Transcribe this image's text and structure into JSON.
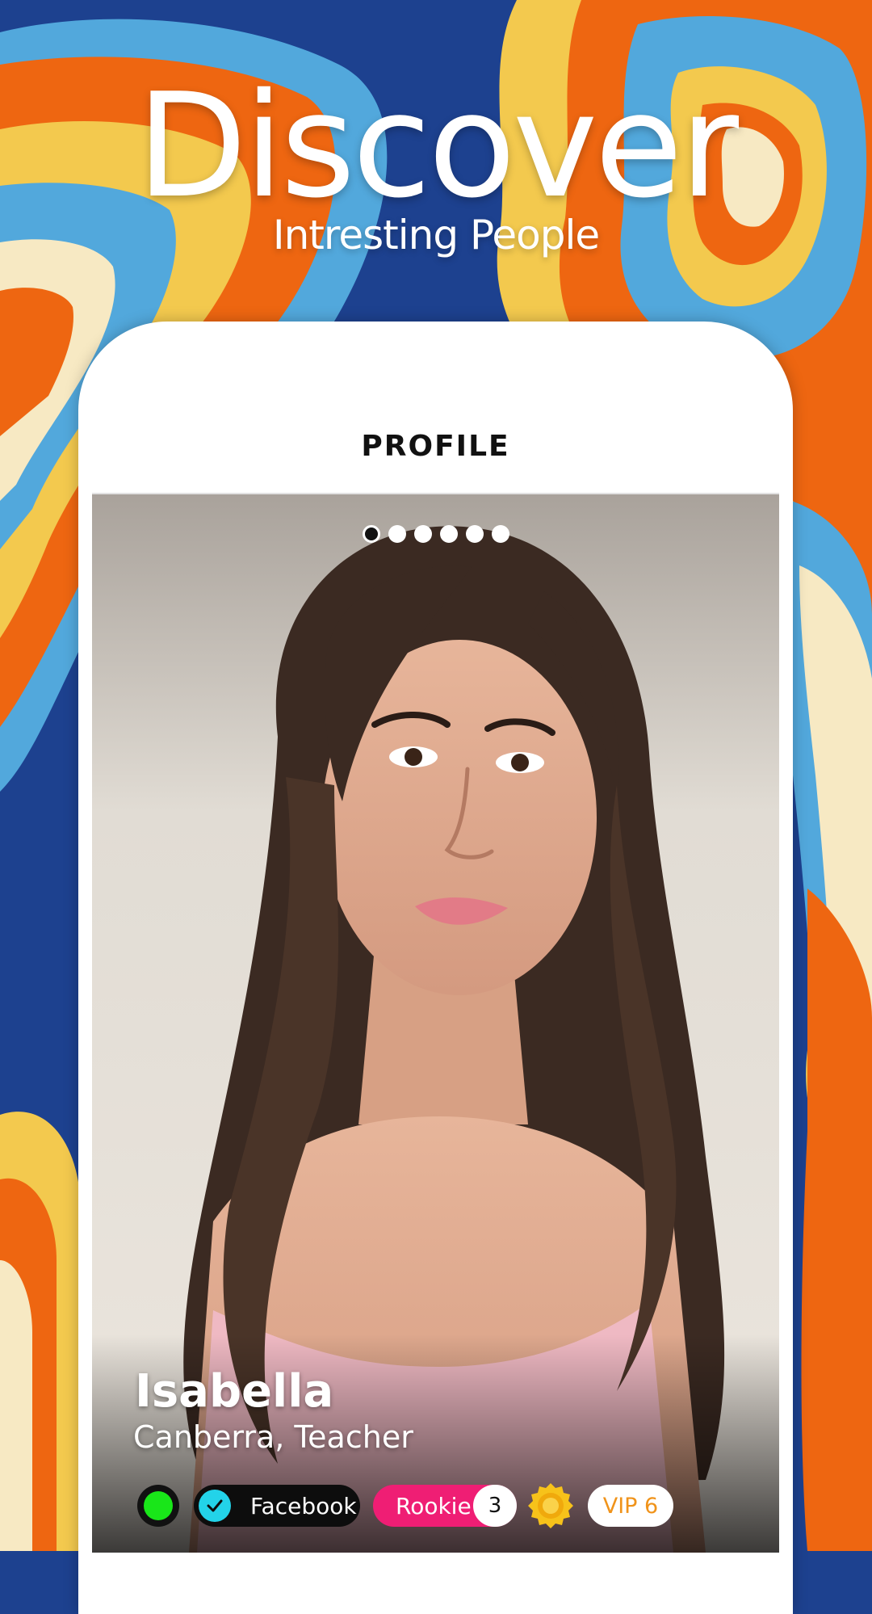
{
  "hero": {
    "title": "Discover",
    "subtitle": "Intresting People"
  },
  "app": {
    "header_title": "PROFILE"
  },
  "gallery": {
    "photo_count": 6,
    "active_index": 0
  },
  "profile": {
    "name": "Isabella",
    "location_job": "Canberra, Teacher",
    "online_status_color": "#19e619"
  },
  "badges": {
    "verified_label": "Facebook",
    "level_label": "Rookie",
    "level_count": "3",
    "vip_label": "VIP 6"
  },
  "colors": {
    "background_blue": "#1d418f",
    "swirl_orange": "#ee6611",
    "swirl_yellow": "#f3c94e",
    "swirl_lightblue": "#52a8dc",
    "swirl_cream": "#f7e9c3",
    "rookie_pink": "#ef1e74",
    "verified_cyan": "#23d3e9",
    "vip_orange": "#f0931a"
  }
}
